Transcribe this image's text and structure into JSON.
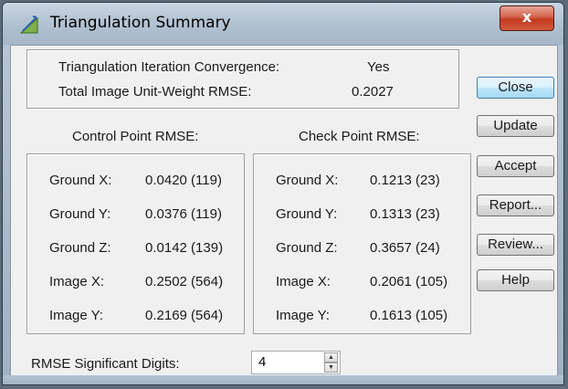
{
  "window": {
    "title": "Triangulation Summary",
    "close_glyph": "x"
  },
  "summary": {
    "convergence_label": "Triangulation Iteration Convergence:",
    "convergence_value": "Yes",
    "rmse_label": "Total Image Unit-Weight RMSE:",
    "rmse_value": "0.2027"
  },
  "control": {
    "heading": "Control Point RMSE:",
    "rows": [
      {
        "label": "Ground X:",
        "value": "0.0420 (119)"
      },
      {
        "label": "Ground Y:",
        "value": "0.0376 (119)"
      },
      {
        "label": "Ground Z:",
        "value": "0.0142 (139)"
      },
      {
        "label": "Image X:",
        "value": "0.2502 (564)"
      },
      {
        "label": "Image Y:",
        "value": "0.2169 (564)"
      }
    ]
  },
  "check": {
    "heading": "Check Point RMSE:",
    "rows": [
      {
        "label": "Ground X:",
        "value": "0.1213 (23)"
      },
      {
        "label": "Ground Y:",
        "value": "0.1313 (23)"
      },
      {
        "label": "Ground Z:",
        "value": "0.3657 (24)"
      },
      {
        "label": "Image X:",
        "value": "0.2061 (105)"
      },
      {
        "label": "Image Y:",
        "value": "0.1613 (105)"
      }
    ]
  },
  "buttons": {
    "close": "Close",
    "update": "Update",
    "accept": "Accept",
    "report": "Report...",
    "review": "Review...",
    "help": "Help"
  },
  "digits": {
    "label": "RMSE Significant Digits:",
    "value": "4"
  },
  "icons": {
    "title": "triangulation-icon",
    "spin_up": "up-arrow-icon",
    "spin_down": "down-arrow-icon"
  }
}
